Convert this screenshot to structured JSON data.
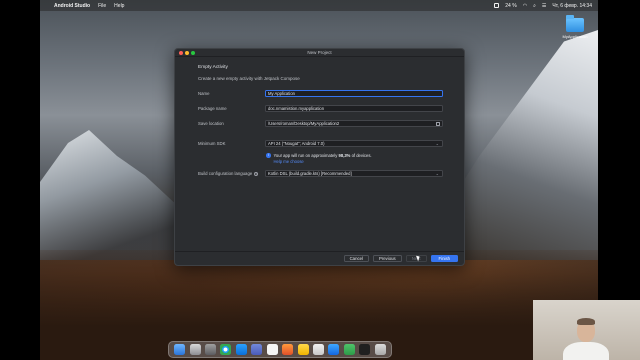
{
  "menubar": {
    "app_name": "Android Studio",
    "menu_items": [
      "File",
      "Help"
    ],
    "battery": "24 %",
    "datetime": "Чт, 6 февр.  14:34"
  },
  "desktop": {
    "folder_label": "MyApplication"
  },
  "dialog": {
    "title": "New Project",
    "heading": "Empty Activity",
    "subheading": "Create a new empty activity with Jetpack Compose",
    "fields": {
      "name": {
        "label": "Name",
        "value": "My Application"
      },
      "package": {
        "label": "Package name",
        "value": "doc.nmamistion.myapplication"
      },
      "location": {
        "label": "Save location",
        "value": "/Users/roman/Desktop/MyApplication2"
      },
      "min_sdk": {
        "label": "Minimum SDK",
        "value": "API 24 (\"Nougat\"; Android 7.0)"
      },
      "build_lang": {
        "label": "Build configuration language",
        "value": "Kotlin DSL (build.gradle.kts) [Recommended]"
      }
    },
    "info": {
      "text_before": "Your app will run on approximately ",
      "percent": "98,3%",
      "text_after": " of devices.",
      "help_link": "Help me choose"
    },
    "buttons": {
      "cancel": "Cancel",
      "previous": "Previous",
      "next": "Next",
      "finish": "Finish"
    }
  }
}
